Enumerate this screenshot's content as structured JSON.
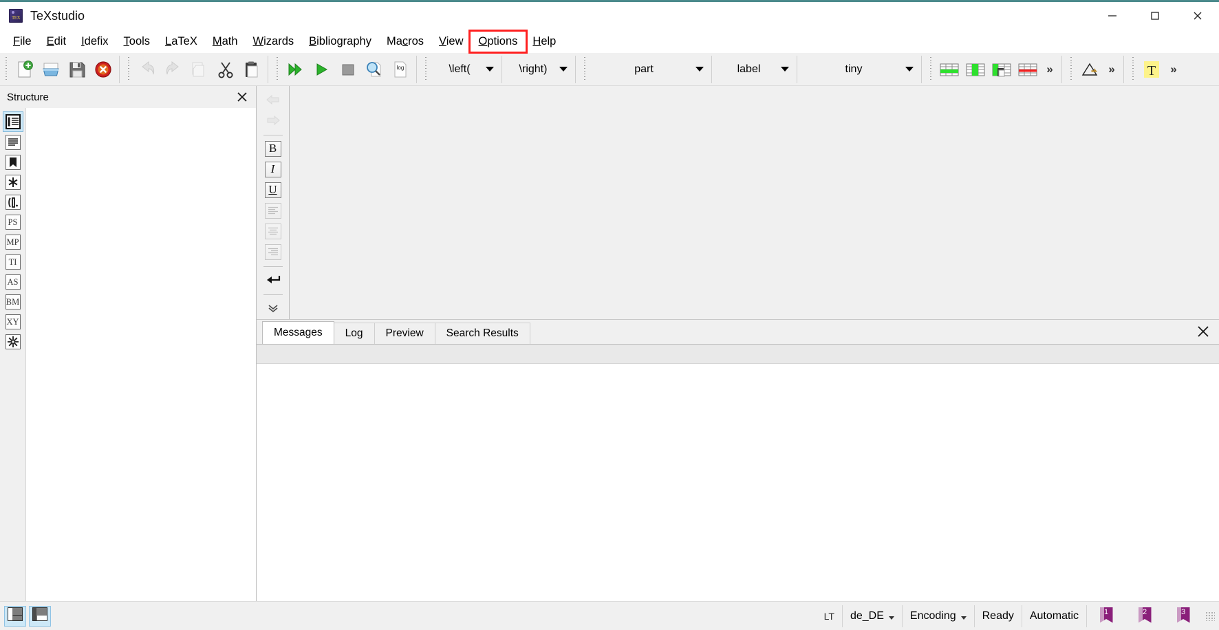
{
  "window": {
    "title": "TeXstudio",
    "app_icon": "texstudio-logo-icon",
    "minimize_icon": "minimize-icon",
    "maximize_icon": "maximize-icon",
    "close_icon": "close-icon"
  },
  "menubar": {
    "highlight_color": "#ff2020",
    "items": [
      {
        "label": "File",
        "mnemonic": "F"
      },
      {
        "label": "Edit",
        "mnemonic": "E"
      },
      {
        "label": "Idefix",
        "mnemonic": "I"
      },
      {
        "label": "Tools",
        "mnemonic": "T"
      },
      {
        "label": "LaTeX",
        "mnemonic": "L"
      },
      {
        "label": "Math",
        "mnemonic": "M"
      },
      {
        "label": "Wizards",
        "mnemonic": "W"
      },
      {
        "label": "Bibliography",
        "mnemonic": "B"
      },
      {
        "label": "Macros",
        "mnemonic": "c"
      },
      {
        "label": "View",
        "mnemonic": "V"
      },
      {
        "label": "Options",
        "mnemonic": "O",
        "highlighted": true
      },
      {
        "label": "Help",
        "mnemonic": "H"
      }
    ]
  },
  "toolbar": {
    "buttons": [
      {
        "name": "new-document-button",
        "icon": "new-document-icon",
        "disabled": false
      },
      {
        "name": "open-document-button",
        "icon": "open-folder-icon",
        "disabled": false
      },
      {
        "name": "save-document-button",
        "icon": "floppy-save-icon",
        "disabled": false
      },
      {
        "name": "close-document-button",
        "icon": "red-close-circle-icon",
        "disabled": false
      },
      {
        "name": "undo-button",
        "icon": "undo-arrow-icon",
        "disabled": true
      },
      {
        "name": "redo-button",
        "icon": "redo-arrow-icon",
        "disabled": true
      },
      {
        "name": "copy-button",
        "icon": "copy-pages-icon",
        "disabled": true
      },
      {
        "name": "cut-button",
        "icon": "scissors-icon",
        "disabled": false
      },
      {
        "name": "paste-button",
        "icon": "clipboard-paste-icon",
        "disabled": false
      },
      {
        "name": "build-and-view-button",
        "icon": "double-green-arrow-icon",
        "disabled": false
      },
      {
        "name": "compile-button",
        "icon": "green-play-arrow-icon",
        "disabled": false
      },
      {
        "name": "stop-button",
        "icon": "grey-stop-square-icon",
        "disabled": false
      },
      {
        "name": "view-log-preview-button",
        "icon": "magnifier-page-icon",
        "disabled": false
      },
      {
        "name": "view-log-button",
        "icon": "log-page-icon",
        "disabled": false
      }
    ],
    "combos": [
      {
        "name": "left-delimiter-combo",
        "value": "\\left(",
        "width": "narrow"
      },
      {
        "name": "right-delimiter-combo",
        "value": "\\right)",
        "width": "narrow"
      },
      {
        "name": "section-level-combo",
        "value": "part",
        "width": "mid"
      },
      {
        "name": "reference-type-combo",
        "value": "label",
        "width": "wide"
      },
      {
        "name": "font-size-combo",
        "value": "tiny",
        "width": "mid"
      }
    ],
    "table_buttons": [
      {
        "name": "insert-table-row-button",
        "icon": "table-insert-row-icon"
      },
      {
        "name": "insert-table-column-button",
        "icon": "table-insert-column-icon"
      },
      {
        "name": "paste-table-column-button",
        "icon": "table-paste-column-icon"
      },
      {
        "name": "remove-table-row-button",
        "icon": "table-remove-row-icon"
      }
    ],
    "overflow_label": "»",
    "extra_buttons": [
      {
        "name": "draw-diagram-button",
        "icon": "triangle-arrow-icon"
      },
      {
        "name": "text-highlight-button",
        "icon": "highlighted-t-icon"
      }
    ]
  },
  "structure_panel": {
    "title": "Structure",
    "close_icon": "close-icon",
    "rail_items": [
      {
        "name": "sidebar-item-structure",
        "glyph": "☰",
        "kind": "structure-list-icon",
        "active": true
      },
      {
        "name": "sidebar-item-symbols-most-used",
        "glyph": "≡",
        "kind": "lines-icon",
        "active": false
      },
      {
        "name": "sidebar-item-bookmarks",
        "glyph": "⚑",
        "kind": "bookmark-icon",
        "active": false
      },
      {
        "name": "sidebar-item-symbols-favorites",
        "glyph": "✱",
        "kind": "asterisk-icon",
        "active": false
      },
      {
        "name": "sidebar-item-delimiters",
        "glyph": "((·",
        "kind": "delimiters-icon",
        "active": false
      },
      {
        "name": "sidebar-item-postscript",
        "glyph": "PS",
        "kind": "ps-icon",
        "active": false
      },
      {
        "name": "sidebar-item-metapost",
        "glyph": "MP",
        "kind": "mp-icon",
        "active": false
      },
      {
        "name": "sidebar-item-tikz",
        "glyph": "TI",
        "kind": "ti-icon",
        "active": false
      },
      {
        "name": "sidebar-item-asymptote",
        "glyph": "AS",
        "kind": "as-icon",
        "active": false
      },
      {
        "name": "sidebar-item-beamer",
        "glyph": "BM",
        "kind": "bm-icon",
        "active": false
      },
      {
        "name": "sidebar-item-xypic",
        "glyph": "XY",
        "kind": "xy-icon",
        "active": false
      },
      {
        "name": "sidebar-item-special",
        "glyph": "✻",
        "kind": "starburst-icon",
        "active": false
      }
    ]
  },
  "format_rail": {
    "buttons": [
      {
        "name": "nav-back-button",
        "glyph": "⬅",
        "kind": "back-arrow-icon",
        "disabled": true,
        "plain": true
      },
      {
        "name": "nav-forward-button",
        "glyph": "➡",
        "kind": "forward-arrow-icon",
        "disabled": true,
        "plain": true
      },
      {
        "name": "bold-button",
        "glyph": "B",
        "kind": "bold-icon",
        "disabled": false,
        "plain": false
      },
      {
        "name": "italic-button",
        "glyph": "I",
        "kind": "italic-icon",
        "disabled": false,
        "plain": false
      },
      {
        "name": "underline-button",
        "glyph": "U",
        "kind": "underline-icon",
        "disabled": false,
        "plain": false
      },
      {
        "name": "align-left-button",
        "glyph": "≡",
        "kind": "align-left-icon",
        "disabled": true,
        "plain": false
      },
      {
        "name": "align-center-button",
        "glyph": "≡",
        "kind": "align-center-icon",
        "disabled": true,
        "plain": false
      },
      {
        "name": "align-right-button",
        "glyph": "≡",
        "kind": "align-right-icon",
        "disabled": true,
        "plain": false
      },
      {
        "name": "newline-button",
        "glyph": "↵",
        "kind": "newline-return-icon",
        "disabled": false,
        "plain": true
      }
    ],
    "expand_glyph": "ˇˇ",
    "expand_name": "expand-more-icon"
  },
  "bottom_panel": {
    "tabs": [
      {
        "label": "Messages",
        "active": true
      },
      {
        "label": "Log",
        "active": false
      },
      {
        "label": "Preview",
        "active": false
      },
      {
        "label": "Search Results",
        "active": false
      }
    ],
    "close_icon": "close-icon"
  },
  "statusbar": {
    "layout_buttons": [
      {
        "name": "toggle-structure-view-button",
        "icon": "layout-left-panel-icon"
      },
      {
        "name": "toggle-output-view-button",
        "icon": "layout-bottom-panel-icon"
      }
    ],
    "language_tool": {
      "label": "LT",
      "name": "languagetool-status-icon"
    },
    "cells": [
      {
        "name": "spell-language-selector",
        "label": "de_DE",
        "dropdown": true
      },
      {
        "name": "encoding-selector",
        "label": "Encoding",
        "dropdown": true
      },
      {
        "name": "status-ready-label",
        "label": "Ready",
        "dropdown": false
      },
      {
        "name": "mode-automatic-label",
        "label": "Automatic",
        "dropdown": false
      }
    ],
    "bookmarks": [
      {
        "name": "bookmark-1-button",
        "number": "1"
      },
      {
        "name": "bookmark-2-button",
        "number": "2"
      },
      {
        "name": "bookmark-3-button",
        "number": "3"
      }
    ],
    "resize_grip": "resize-grip-icon",
    "bookmark_color": "#8a1f7a"
  }
}
